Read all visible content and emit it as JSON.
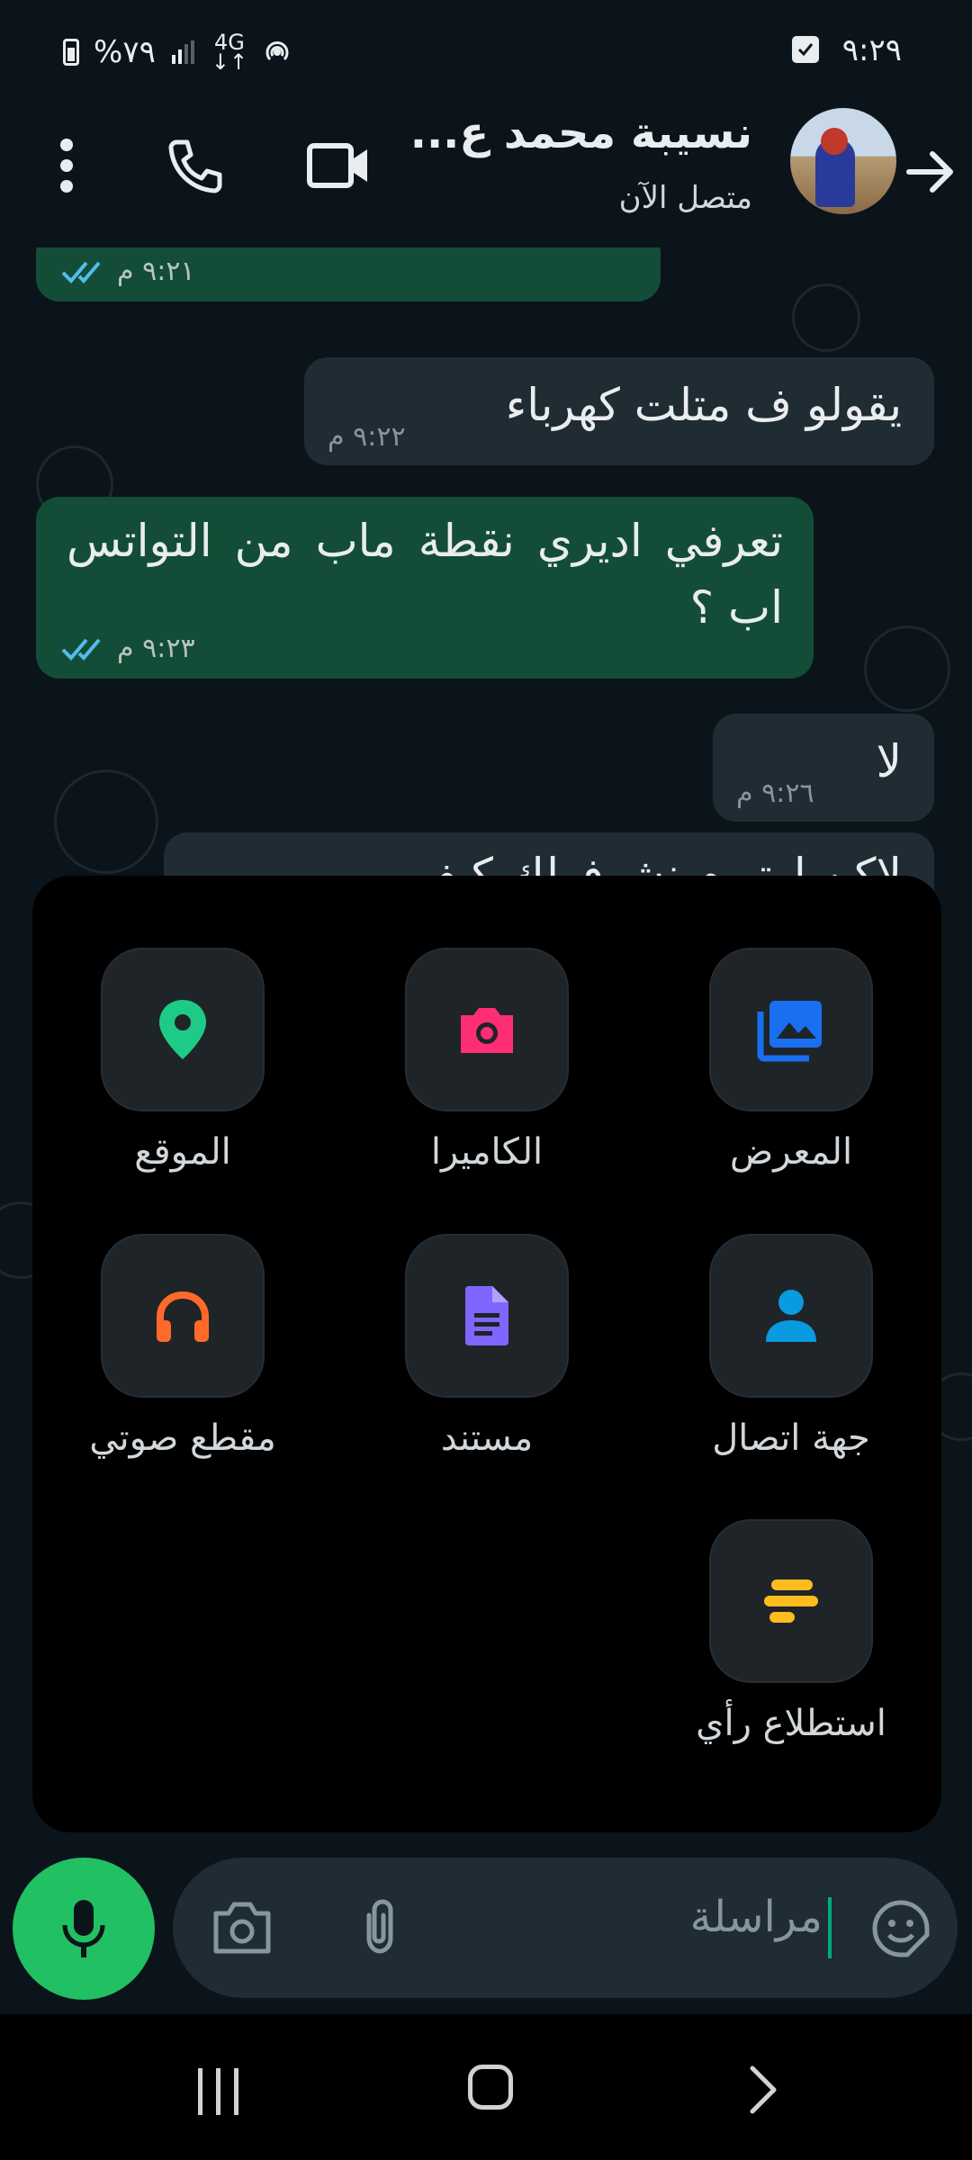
{
  "status_bar": {
    "time": "٩:٢٩",
    "battery": "%٧٩",
    "network": "4G"
  },
  "header": {
    "contact_name": "نسيبة محمد ع...",
    "contact_status": "متصل الآن"
  },
  "messages": [
    {
      "direction": "out",
      "text": "",
      "time": "٩:٢١ م",
      "read": true
    },
    {
      "direction": "in",
      "text": "يقولو ف متلت كهرباء",
      "time": "٩:٢٢ م"
    },
    {
      "direction": "out",
      "text": "تعرفي اديري نقطة ماب من التواتس اب ؟",
      "time": "٩:٢٣ م",
      "read": true
    },
    {
      "direction": "in",
      "text": "لا",
      "time": "٩:٢٦ م"
    },
    {
      "direction": "in",
      "text": "لاكن اوتو م نشوفولك كيف",
      "time": ""
    }
  ],
  "attach_menu": {
    "gallery": "المعرض",
    "camera": "الكاميرا",
    "location": "الموقع",
    "contact": "جهة اتصال",
    "document": "مستند",
    "audio": "مقطع صوتي",
    "poll": "استطلاع رأي"
  },
  "input": {
    "placeholder": "مراسلة"
  },
  "colors": {
    "outgoing_bubble": "#144d37",
    "incoming_bubble": "#202c33",
    "accent_green": "#21c063",
    "gallery": "#1a6ff0",
    "camera": "#ff2e74",
    "location": "#1ecb86",
    "contact": "#0a9ae0",
    "document": "#7f66ff",
    "audio": "#ff6a2a",
    "poll": "#ffbc1e"
  }
}
